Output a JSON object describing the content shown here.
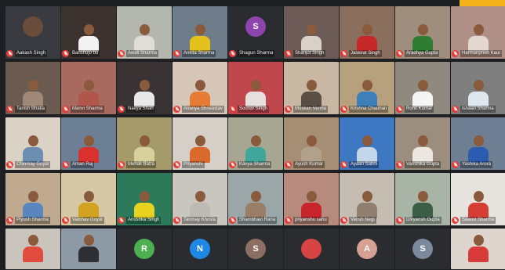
{
  "meeting": {
    "accent_color": "#f6b21a",
    "mic_state": "muted",
    "mic_icon": "mic-off-icon",
    "rows": [
      [
        {
          "name": "Aakash Singh",
          "type": "avatar",
          "avatar_letter": "",
          "bg": "#3a3b40",
          "avatar_color": "#6b4b3a"
        },
        {
          "name": "Banshujo bu",
          "type": "video",
          "bg": "#3c3330",
          "shirt": "#f2f2f2"
        },
        {
          "name": "Awali Sharma",
          "type": "video",
          "bg": "#b4b7ae",
          "shirt": "#e0dcd6"
        },
        {
          "name": "Ankita Sharma",
          "type": "video",
          "bg": "#6f7c8a",
          "shirt": "#e3c21e"
        },
        {
          "name": "Shagun Sharma",
          "type": "avatar",
          "avatar_letter": "S",
          "bg": "#2b2c30",
          "avatar_color": "#8e44ad"
        },
        {
          "name": "Shanjot Singh",
          "type": "video",
          "bg": "#6c5b56",
          "shirt": "#d8d0c9"
        },
        {
          "name": "Jaskirat Singh",
          "type": "video",
          "bg": "#8a6f5e",
          "shirt": "#c62828"
        },
        {
          "name": "Aradhya Gupta",
          "type": "video",
          "bg": "#9f8e7e",
          "shirt": "#2e7d32"
        },
        {
          "name": "Harmanpreet Kaur",
          "type": "video",
          "bg": "#b08f86",
          "shirt": "#e4d7d0"
        }
      ],
      [
        {
          "name": "Tanish Bhatia",
          "type": "video",
          "bg": "#6b5a4f",
          "shirt": "#a08879"
        },
        {
          "name": "Manvi Sharma",
          "type": "video",
          "bg": "#a8695f",
          "shirt": "#b2564b"
        },
        {
          "name": "Navya Shah",
          "type": "video",
          "bg": "#3a3334",
          "shirt": "#e8e8e8"
        },
        {
          "name": "Ananya Shrivastav",
          "type": "video",
          "bg": "#d6c7b9",
          "shirt": "#e57c36"
        },
        {
          "name": "Sourav Singh",
          "type": "video",
          "bg": "#c0484c",
          "shirt": "#e6dfe0"
        },
        {
          "name": "Muskan Verma",
          "type": "video",
          "bg": "#c8b8a3",
          "shirt": "#5a4e45"
        },
        {
          "name": "Krishna Chauhan",
          "type": "video",
          "bg": "#b7a07e",
          "shirt": "#3d7fb8"
        },
        {
          "name": "Rohit Kumar",
          "type": "video",
          "bg": "#8e8a80",
          "shirt": "#f5f5f5"
        },
        {
          "name": "Ishaan Sharma",
          "type": "video",
          "bg": "#7e7e7e",
          "shirt": "#dfe7ee"
        }
      ],
      [
        {
          "name": "Chinmay Goyal",
          "type": "video",
          "bg": "#d9d2c5",
          "shirt": "#6c8fb1"
        },
        {
          "name": "Aman Raj",
          "type": "video",
          "bg": "#6c7f94",
          "shirt": "#d9322e"
        },
        {
          "name": "Mehak Batra",
          "type": "video",
          "bg": "#a59a6a",
          "shirt": "#d6d19c"
        },
        {
          "name": "Priyanshi",
          "type": "video",
          "bg": "#d5cfc8",
          "shirt": "#d96a2c"
        },
        {
          "name": "Kavya Sharma",
          "type": "video",
          "bg": "#a7a693",
          "shirt": "#3fa69a"
        },
        {
          "name": "Ayush Kumar",
          "type": "video",
          "bg": "#a68e74",
          "shirt": "#b1a18a"
        },
        {
          "name": "Ayaan Sahni",
          "type": "video",
          "bg": "#3e77c2",
          "shirt": "#c4d6ea"
        },
        {
          "name": "Vanshika Gupta",
          "type": "video",
          "bg": "#9c8e7e",
          "shirt": "#ece7e1"
        },
        {
          "name": "Yashika Arora",
          "type": "video",
          "bg": "#6f7f93",
          "shirt": "#2a5db0"
        }
      ],
      [
        {
          "name": "Piyush Sharma",
          "type": "video",
          "bg": "#bfa98f",
          "shirt": "#5a86c0"
        },
        {
          "name": "Vaibhav Goyal",
          "type": "video",
          "bg": "#d6c8a4",
          "shirt": "#d1a321"
        },
        {
          "name": "Anushka Singh",
          "type": "video",
          "bg": "#2d7a5b",
          "shirt": "#e7d31f"
        },
        {
          "name": "Tanmay Khosla",
          "type": "video",
          "bg": "#c9c6c0",
          "shirt": "#bdbab3"
        },
        {
          "name": "Shambhavi Rana",
          "type": "video",
          "bg": "#9aa6a8",
          "shirt": "#9a7d66"
        },
        {
          "name": "priyanshu sahu",
          "type": "video",
          "bg": "#b68b7e",
          "shirt": "#c8242c"
        },
        {
          "name": "Vansh Negi",
          "type": "video",
          "bg": "#c6bdb2",
          "shirt": "#8e7f6f"
        },
        {
          "name": "Divyansh Gupta",
          "type": "video",
          "bg": "#a8b4a6",
          "shirt": "#3c5d46"
        },
        {
          "name": "Saanvi Sharma",
          "type": "video",
          "bg": "#e7e4df",
          "shirt": "#d53d35"
        }
      ],
      [
        {
          "name": "",
          "type": "video",
          "bg": "#c9c5bd",
          "shirt": "#e24c3e"
        },
        {
          "name": "",
          "type": "video",
          "bg": "#8d9aa5",
          "shirt": "#2d2f33"
        },
        {
          "name": "",
          "type": "avatar",
          "avatar_letter": "R",
          "bg": "#2b2c30",
          "avatar_color": "#4caf50"
        },
        {
          "name": "",
          "type": "avatar",
          "avatar_letter": "N",
          "bg": "#2b2c30",
          "avatar_color": "#1e88e5"
        },
        {
          "name": "",
          "type": "avatar",
          "avatar_letter": "S",
          "bg": "#2b2c30",
          "avatar_color": "#8d6e63"
        },
        {
          "name": "",
          "type": "avatar",
          "avatar_letter": "",
          "bg": "#2b2c30",
          "avatar_color": "#d84343"
        },
        {
          "name": "",
          "type": "avatar",
          "avatar_letter": "A",
          "bg": "#2b2c30",
          "avatar_color": "#d4a192"
        },
        {
          "name": "",
          "type": "avatar",
          "avatar_letter": "S",
          "bg": "#2b2c30",
          "avatar_color": "#7b8a9c"
        },
        {
          "name": "",
          "type": "video",
          "bg": "#dfd5cf",
          "shirt": "#d83a3a"
        }
      ]
    ]
  }
}
